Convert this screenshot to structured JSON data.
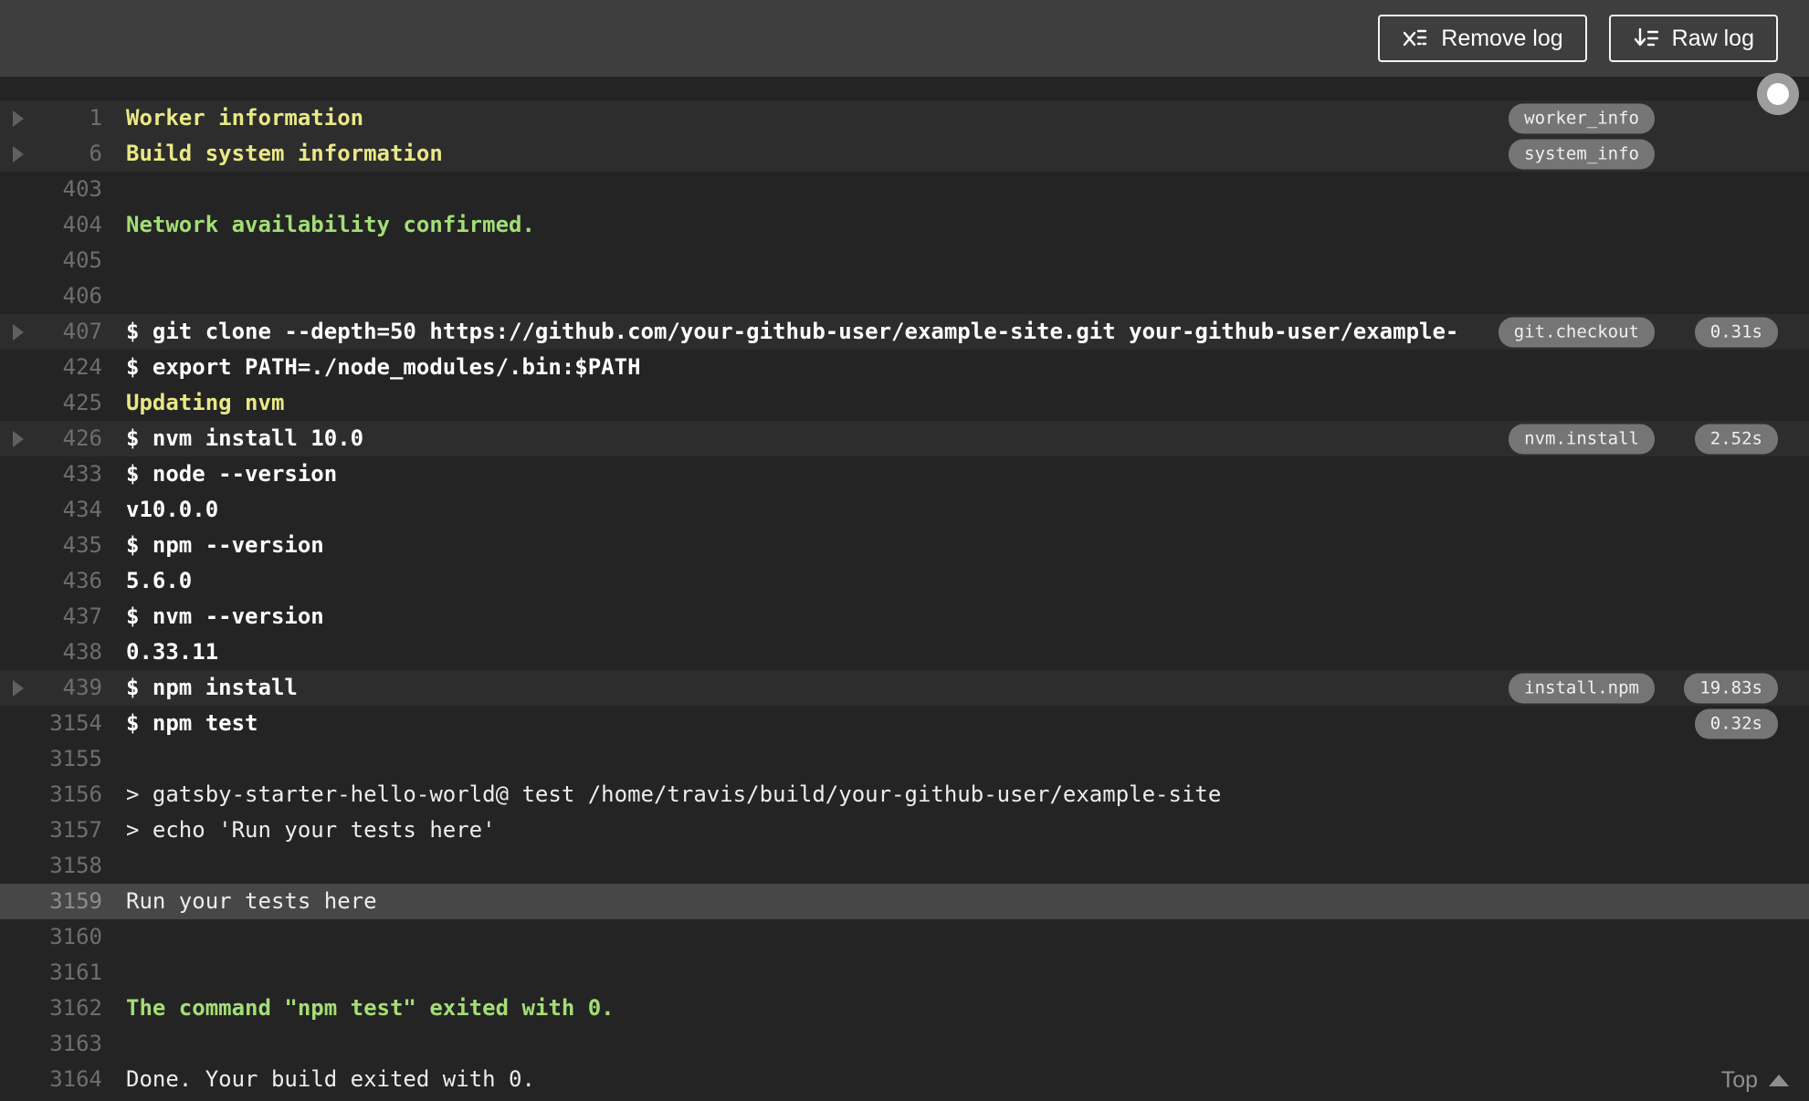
{
  "toolbar": {
    "remove_log_label": "Remove log",
    "raw_log_label": "Raw log"
  },
  "footer": {
    "top_label": "Top"
  },
  "colors": {
    "topbar_bg": "#3e3e3e",
    "log_bg": "#242424",
    "fold_row_bg": "#2d2d2d",
    "selected_row_bg": "#474747",
    "yellow_text": "#eae886",
    "green_text": "#a3de76",
    "command_text": "#ffffff",
    "plain_text": "#ededed",
    "line_number": "#6e6e6e",
    "badge_bg": "#757575"
  },
  "log": {
    "rows": [
      {
        "num": "1",
        "text": "Worker information",
        "style": "yellow",
        "fold": true,
        "badge": "worker_info"
      },
      {
        "num": "6",
        "text": "Build system information",
        "style": "yellow",
        "fold": true,
        "badge": "system_info"
      },
      {
        "num": "403",
        "text": "",
        "style": "plain"
      },
      {
        "num": "404",
        "text": "Network availability confirmed.",
        "style": "green"
      },
      {
        "num": "405",
        "text": "",
        "style": "plain"
      },
      {
        "num": "406",
        "text": "",
        "style": "plain"
      },
      {
        "num": "407",
        "text": "$ git clone --depth=50 https://github.com/your-github-user/example-site.git your-github-user/example-",
        "style": "command",
        "fold": true,
        "badge": "git.checkout",
        "duration": "0.31s"
      },
      {
        "num": "424",
        "text": "$ export PATH=./node_modules/.bin:$PATH",
        "style": "command"
      },
      {
        "num": "425",
        "text": "Updating nvm",
        "style": "yellow"
      },
      {
        "num": "426",
        "text": "$ nvm install 10.0",
        "style": "command",
        "fold": true,
        "badge": "nvm.install",
        "duration": "2.52s"
      },
      {
        "num": "433",
        "text": "$ node --version",
        "style": "command"
      },
      {
        "num": "434",
        "text": "v10.0.0",
        "style": "command"
      },
      {
        "num": "435",
        "text": "$ npm --version",
        "style": "command"
      },
      {
        "num": "436",
        "text": "5.6.0",
        "style": "command"
      },
      {
        "num": "437",
        "text": "$ nvm --version",
        "style": "command"
      },
      {
        "num": "438",
        "text": "0.33.11",
        "style": "command"
      },
      {
        "num": "439",
        "text": "$ npm install",
        "style": "command",
        "fold": true,
        "badge": "install.npm",
        "duration": "19.83s"
      },
      {
        "num": "3154",
        "text": "$ npm test",
        "style": "command",
        "duration": "0.32s"
      },
      {
        "num": "3155",
        "text": "",
        "style": "plain"
      },
      {
        "num": "3156",
        "text": "> gatsby-starter-hello-world@ test /home/travis/build/your-github-user/example-site",
        "style": "plain"
      },
      {
        "num": "3157",
        "text": "> echo 'Run your tests here'",
        "style": "plain"
      },
      {
        "num": "3158",
        "text": "",
        "style": "plain"
      },
      {
        "num": "3159",
        "text": "Run your tests here",
        "style": "plain",
        "selected": true
      },
      {
        "num": "3160",
        "text": "",
        "style": "plain"
      },
      {
        "num": "3161",
        "text": "",
        "style": "plain"
      },
      {
        "num": "3162",
        "text": "The command \"npm test\" exited with 0.",
        "style": "green"
      },
      {
        "num": "3163",
        "text": "",
        "style": "plain"
      },
      {
        "num": "3164",
        "text": "Done. Your build exited with 0.",
        "style": "plain"
      }
    ]
  }
}
